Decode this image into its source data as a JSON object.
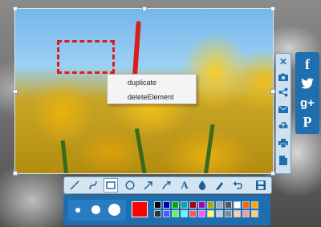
{
  "context_menu": {
    "items": [
      "duplicate",
      "deleteElement"
    ]
  },
  "right_toolbar": {
    "icons": [
      "close-icon",
      "camera-icon",
      "share-icon",
      "mail-icon",
      "upload-icon",
      "print-icon",
      "document-icon"
    ]
  },
  "social": {
    "facebook": "f",
    "twitter": "🐦",
    "googleplus": "g+",
    "pinterest": "P"
  },
  "drawing_toolbar": {
    "tools": [
      "line",
      "curve",
      "rectangle",
      "ellipse",
      "arrow",
      "arrow-curved",
      "text",
      "fill",
      "highlighter",
      "undo",
      "save"
    ],
    "selected": "rectangle",
    "text_glyph": "A"
  },
  "palette": {
    "current_color": "#ff0000",
    "brush_sizes": [
      "small",
      "medium",
      "large"
    ],
    "colors": [
      "#000000",
      "#0000aa",
      "#00aa00",
      "#00aaaa",
      "#aa0000",
      "#aa00aa",
      "#aaaa00",
      "#aaaaaa",
      "#555555",
      "#ffffff",
      "#ff6600",
      "#ffaa00",
      "#333333",
      "#5555ff",
      "#55ff55",
      "#55ffff",
      "#ff5555",
      "#ff55ff",
      "#ffff55",
      "#cccccc",
      "#888888",
      "#ffccaa",
      "#ff9999",
      "#ffcc66"
    ]
  }
}
